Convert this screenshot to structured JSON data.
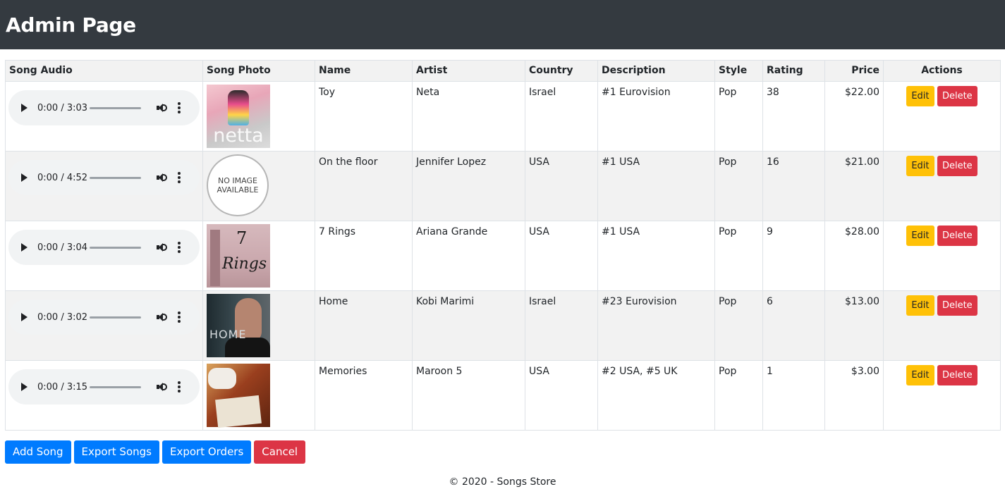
{
  "header": {
    "title": "Admin Page"
  },
  "table": {
    "columns": {
      "audio": "Song Audio",
      "photo": "Song Photo",
      "name": "Name",
      "artist": "Artist",
      "country": "Country",
      "description": "Description",
      "style": "Style",
      "rating": "Rating",
      "price": "Price",
      "actions": "Actions"
    },
    "rows": [
      {
        "audio_time": "0:00 / 3:03",
        "photo": "album-cover-toy",
        "photo_text": "netta",
        "name": "Toy",
        "artist": "Neta",
        "country": "Israel",
        "description": "#1 Eurovision",
        "style": "Pop",
        "rating": "38",
        "price": "$22.00"
      },
      {
        "audio_time": "0:00 / 4:52",
        "photo": "no-image-placeholder",
        "photo_text": "NO IMAGE AVAILABLE",
        "name": "On the floor",
        "artist": "Jennifer Lopez",
        "country": "USA",
        "description": "#1 USA",
        "style": "Pop",
        "rating": "16",
        "price": "$21.00"
      },
      {
        "audio_time": "0:00 / 3:04",
        "photo": "album-cover-7-rings",
        "photo_text": "7",
        "name": "7 Rings",
        "artist": "Ariana Grande",
        "country": "USA",
        "description": "#1 USA",
        "style": "Pop",
        "rating": "9",
        "price": "$28.00"
      },
      {
        "audio_time": "0:00 / 3:02",
        "photo": "album-cover-home",
        "photo_text": "HOME",
        "name": "Home",
        "artist": "Kobi Marimi",
        "country": "Israel",
        "description": "#23 Eurovision",
        "style": "Pop",
        "rating": "6",
        "price": "$13.00"
      },
      {
        "audio_time": "0:00 / 3:15",
        "photo": "album-cover-memories",
        "photo_text": "",
        "name": "Memories",
        "artist": "Maroon 5",
        "country": "USA",
        "description": "#2 USA, #5 UK",
        "style": "Pop",
        "rating": "1",
        "price": "$3.00"
      }
    ],
    "row_actions": {
      "edit_label": "Edit",
      "delete_label": "Delete"
    }
  },
  "actions": {
    "add_song": "Add Song",
    "export_songs": "Export Songs",
    "export_orders": "Export Orders",
    "cancel": "Cancel"
  },
  "footer": {
    "text": "© 2020 - Songs Store"
  },
  "colors": {
    "header_bg": "#343a40",
    "primary": "#007bff",
    "warning": "#ffc107",
    "danger": "#dc3545",
    "row_stripe": "#f2f2f2"
  }
}
